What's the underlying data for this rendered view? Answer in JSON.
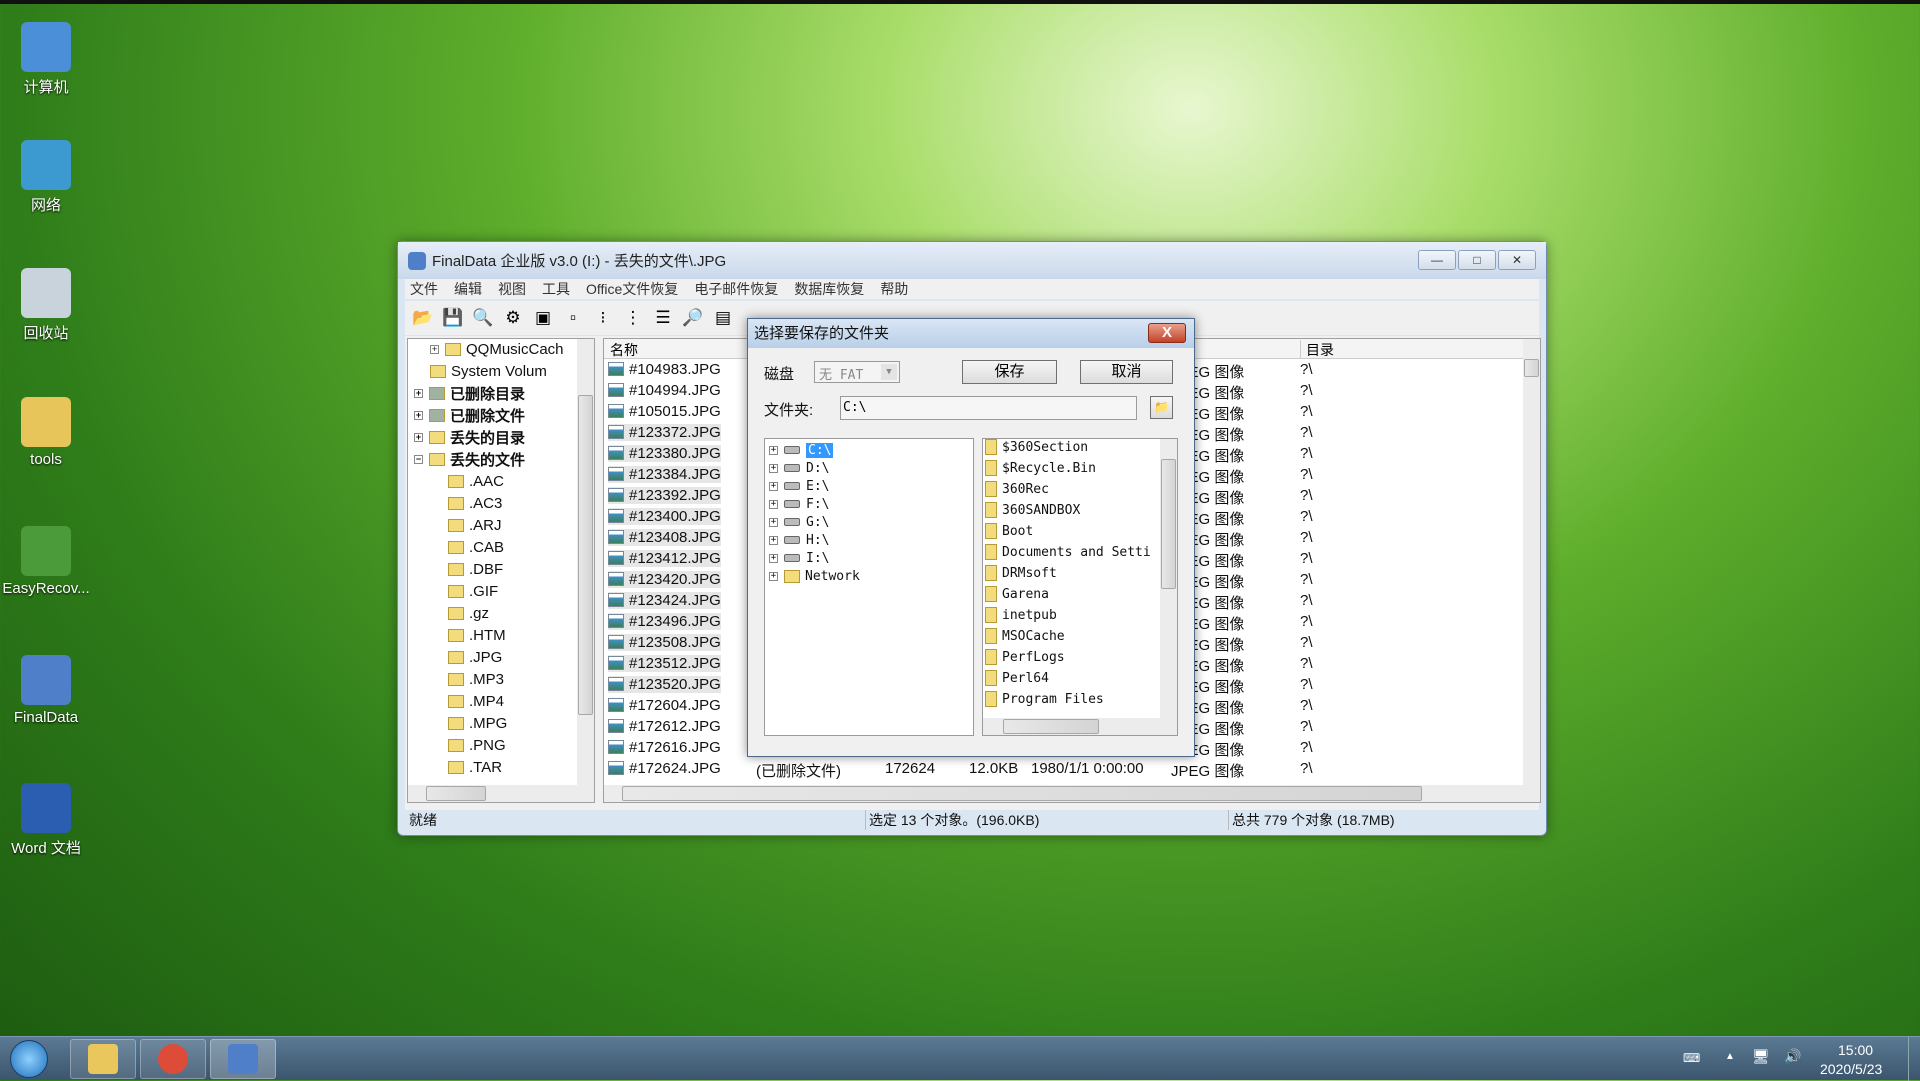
{
  "desktop": {
    "icons": [
      {
        "label": "计算机",
        "icon": "computer-icon",
        "color": "#4a8fd8"
      },
      {
        "label": "网络",
        "icon": "network-icon",
        "color": "#3c9ad0"
      },
      {
        "label": "回收站",
        "icon": "recycle-bin-icon",
        "color": "#c9d3dc"
      },
      {
        "label": "tools",
        "icon": "folder-icon",
        "color": "#e7c55a"
      },
      {
        "label": "EasyRecov...",
        "icon": "easyrecovery-icon",
        "color": "#4b9b3a"
      },
      {
        "label": "FinalData",
        "icon": "finaldata-icon",
        "color": "#4f7fc8"
      },
      {
        "label": "Word 文档",
        "icon": "word-doc-icon",
        "color": "#2b5eb0"
      }
    ]
  },
  "window": {
    "title": "FinalData 企业版 v3.0 (I:) - 丢失的文件\\.JPG",
    "buttons": [
      "—",
      "□",
      "✕"
    ],
    "menu": [
      "文件",
      "编辑",
      "视图",
      "工具",
      "Office文件恢复",
      "电子邮件恢复",
      "数据库恢复",
      "帮助"
    ],
    "toolbar": [
      {
        "icon": "open-icon",
        "glyph": "📂"
      },
      {
        "icon": "save-icon",
        "glyph": "💾"
      },
      {
        "icon": "search-icon",
        "glyph": "🔍"
      },
      {
        "icon": "settings-icon",
        "glyph": "⚙"
      },
      {
        "icon": "large-icons-icon",
        "glyph": "▣"
      },
      {
        "icon": "small-icons-icon",
        "glyph": "▫"
      },
      {
        "icon": "list-view-icon",
        "glyph": "⁝"
      },
      {
        "icon": "tree-view-icon",
        "glyph": "⋮"
      },
      {
        "icon": "details-view-icon",
        "glyph": "☰"
      },
      {
        "icon": "preview-icon",
        "glyph": "🔎"
      },
      {
        "icon": "window-icon",
        "glyph": "▤"
      }
    ],
    "tree": [
      {
        "label": "QQMusicCach",
        "level": 2,
        "exp": "+",
        "bold": false
      },
      {
        "label": "System Volum",
        "level": 2,
        "exp": "",
        "bold": false
      },
      {
        "label": "已删除目录",
        "level": 1,
        "exp": "+",
        "bold": true
      },
      {
        "label": "已删除文件",
        "level": 1,
        "exp": "+",
        "bold": true
      },
      {
        "label": "丢失的目录",
        "level": 1,
        "exp": "+",
        "bold": true
      },
      {
        "label": "丢失的文件",
        "level": 1,
        "exp": "−",
        "bold": true
      },
      {
        "label": ".AAC",
        "level": 2
      },
      {
        "label": ".AC3",
        "level": 2
      },
      {
        "label": ".ARJ",
        "level": 2
      },
      {
        "label": ".CAB",
        "level": 2
      },
      {
        "label": ".DBF",
        "level": 2
      },
      {
        "label": ".GIF",
        "level": 2
      },
      {
        "label": ".gz",
        "level": 2
      },
      {
        "label": ".HTM",
        "level": 2
      },
      {
        "label": ".JPG",
        "level": 2
      },
      {
        "label": ".MP3",
        "level": 2
      },
      {
        "label": ".MP4",
        "level": 2
      },
      {
        "label": ".MPG",
        "level": 2
      },
      {
        "label": ".PNG",
        "level": 2
      },
      {
        "label": ".TAR",
        "level": 2
      }
    ],
    "columns": {
      "name": "名称",
      "dir": "目录"
    },
    "rows": [
      {
        "name": "#104983.JPG",
        "type": "JPEG 图像",
        "dir": "?\\",
        "sel": false
      },
      {
        "name": "#104994.JPG",
        "type": "JPEG 图像",
        "dir": "?\\",
        "sel": false
      },
      {
        "name": "#105015.JPG",
        "type": "JPEG 图像",
        "dir": "?\\",
        "sel": false
      },
      {
        "name": "#123372.JPG",
        "type": "JPEG 图像",
        "dir": "?\\",
        "sel": true
      },
      {
        "name": "#123380.JPG",
        "type": "JPEG 图像",
        "dir": "?\\",
        "sel": true
      },
      {
        "name": "#123384.JPG",
        "type": "JPEG 图像",
        "dir": "?\\",
        "sel": true
      },
      {
        "name": "#123392.JPG",
        "type": "JPEG 图像",
        "dir": "?\\",
        "sel": true
      },
      {
        "name": "#123400.JPG",
        "type": "JPEG 图像",
        "dir": "?\\",
        "sel": true
      },
      {
        "name": "#123408.JPG",
        "type": "JPEG 图像",
        "dir": "?\\",
        "sel": true
      },
      {
        "name": "#123412.JPG",
        "type": "JPEG 图像",
        "dir": "?\\",
        "sel": true
      },
      {
        "name": "#123420.JPG",
        "type": "JPEG 图像",
        "dir": "?\\",
        "sel": true
      },
      {
        "name": "#123424.JPG",
        "type": "JPEG 图像",
        "dir": "?\\",
        "sel": true
      },
      {
        "name": "#123496.JPG",
        "type": "JPEG 图像",
        "dir": "?\\",
        "sel": true
      },
      {
        "name": "#123508.JPG",
        "type": "JPEG 图像",
        "dir": "?\\",
        "sel": true
      },
      {
        "name": "#123512.JPG",
        "type": "JPEG 图像",
        "dir": "?\\",
        "sel": true
      },
      {
        "name": "#123520.JPG",
        "type": "JPEG 图像",
        "dir": "?\\",
        "sel": true
      },
      {
        "name": "#172604.JPG",
        "type": "JPEG 图像",
        "dir": "?\\",
        "sel": false
      },
      {
        "name": "#172612.JPG",
        "type": "JPEG 图像",
        "dir": "?\\",
        "sel": false
      },
      {
        "name": "#172616.JPG",
        "type": "JPEG 图像",
        "dir": "?\\",
        "sel": false
      },
      {
        "name": "#172624.JPG",
        "status": "(已删除文件)",
        "cluster": "172624",
        "size": "12.0KB",
        "date": "1980/1/1 0:00:00",
        "type": "JPEG 图像",
        "dir": "?\\",
        "sel": false
      }
    ],
    "status": {
      "ready": "就绪",
      "selected": "选定 13 个对象。(196.0KB)",
      "total": "总共 779 个对象 (18.7MB)"
    }
  },
  "dialog": {
    "title": "选择要保存的文件夹",
    "close": "X",
    "disk_label": "磁盘",
    "disk_value": "无 FAT",
    "save": "保存",
    "cancel": "取消",
    "folder_label": "文件夹:",
    "folder_value": "C:\\",
    "drives": [
      "C:\\",
      "D:\\",
      "E:\\",
      "F:\\",
      "G:\\",
      "H:\\",
      "I:\\",
      "Network"
    ],
    "folders": [
      "$360Section",
      "$Recycle.Bin",
      "360Rec",
      "360SANDBOX",
      "Boot",
      "Documents and Setti",
      "DRMsoft",
      "Garena",
      "inetpub",
      "MSOCache",
      "PerfLogs",
      "Perl64",
      "Program Files"
    ]
  },
  "taskbar": {
    "time": "15:00",
    "date": "2020/5/23",
    "items": [
      {
        "icon": "explorer-icon",
        "color": "#e9c75c"
      },
      {
        "icon": "chrome-icon",
        "color": "#dd4b39"
      },
      {
        "icon": "finaldata-icon",
        "color": "#4f7fc8"
      }
    ]
  }
}
